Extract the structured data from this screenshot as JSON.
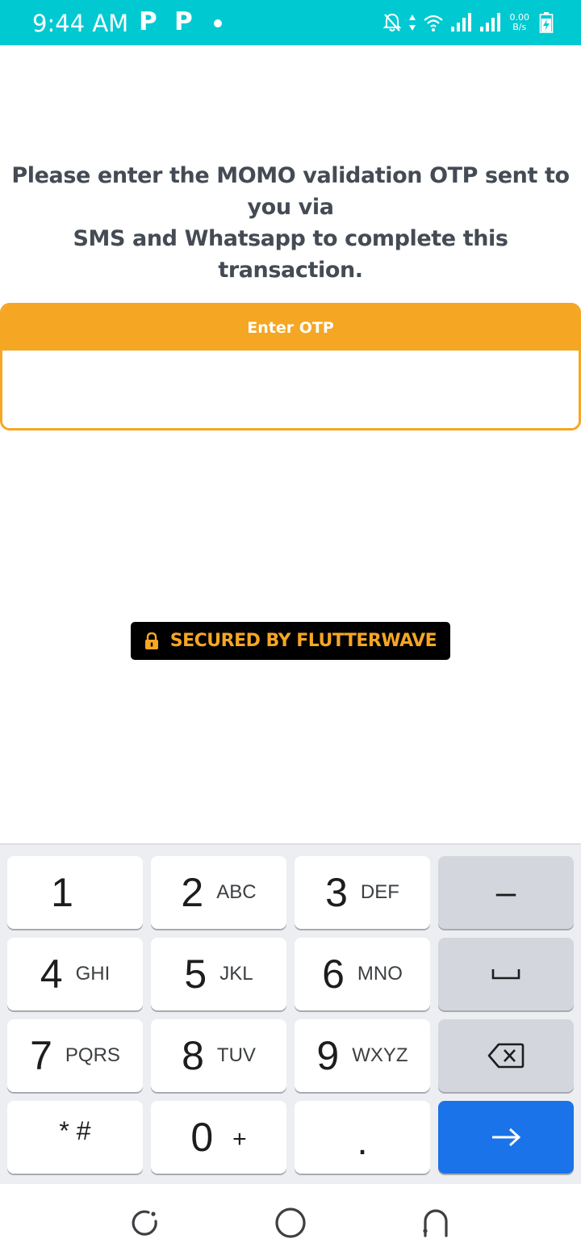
{
  "status_bar": {
    "time": "9:44 AM",
    "notif_icons": [
      "P",
      "P"
    ],
    "speed_value": "0.00",
    "speed_unit": "B/s",
    "color": "#00c9d2"
  },
  "instruction": {
    "line1": "Please enter the MOMO validation OTP sent to you via",
    "line2": "SMS and Whatsapp to complete this transaction."
  },
  "otp": {
    "header": "Enter OTP",
    "value": "",
    "accent_color": "#f5a623"
  },
  "secured_badge": {
    "label": "SECURED BY FLUTTERWAVE",
    "icon": "lock-icon"
  },
  "keyboard": {
    "keys": [
      {
        "num": "1",
        "letters": ""
      },
      {
        "num": "2",
        "letters": "ABC"
      },
      {
        "num": "3",
        "letters": "DEF"
      },
      {
        "num": "4",
        "letters": "GHI"
      },
      {
        "num": "5",
        "letters": "JKL"
      },
      {
        "num": "6",
        "letters": "MNO"
      },
      {
        "num": "7",
        "letters": "PQRS"
      },
      {
        "num": "8",
        "letters": "TUV"
      },
      {
        "num": "9",
        "letters": "WXYZ"
      },
      {
        "num": "0",
        "letters": "+"
      }
    ],
    "symbols_key": "* #",
    "period_key": ".",
    "minus_key": "–",
    "space_icon": "space-icon",
    "backspace_icon": "backspace-icon",
    "enter_icon": "arrow-right-icon",
    "enter_color": "#1a73e8"
  },
  "nav_bar": {
    "icons": [
      "recent-apps-icon",
      "home-icon",
      "back-icon"
    ]
  }
}
